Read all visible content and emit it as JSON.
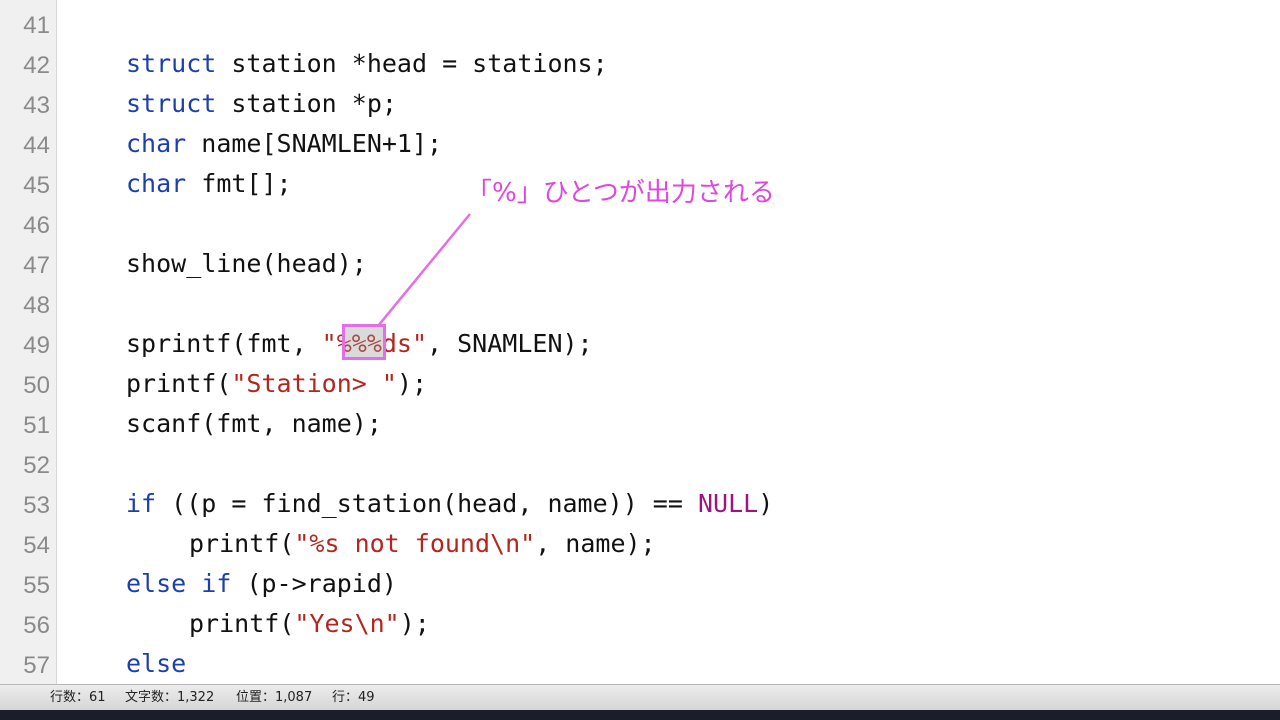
{
  "line_numbers": [
    "41",
    "42",
    "43",
    "44",
    "45",
    "46",
    "47",
    "48",
    "49",
    "50",
    "51",
    "52",
    "53",
    "54",
    "55",
    "56",
    "57"
  ],
  "code": {
    "l42": {
      "kw": "struct",
      "rest": " station *head = stations;"
    },
    "l43": {
      "kw": "struct",
      "rest": " station *p;"
    },
    "l44": {
      "kw": "char",
      "rest": " name[SNAMLEN+1];"
    },
    "l45": {
      "kw": "char",
      "rest": " fmt[];"
    },
    "l47": {
      "text": "show_line(head);"
    },
    "l49": {
      "pre": "sprintf(fmt, ",
      "str": "\"%%%ds\"",
      "post": ", SNAMLEN);"
    },
    "l50": {
      "pre": "printf(",
      "str": "\"Station> \"",
      "post": ");"
    },
    "l51": {
      "text": "scanf(fmt, name);"
    },
    "l53": {
      "kw": "if",
      "pre": " ((p = find_station(head, name)) == ",
      "const": "NULL",
      "post": ")"
    },
    "l54": {
      "pre": "printf(",
      "str": "\"%s not found\\n\"",
      "post": ", name);"
    },
    "l55": {
      "kw1": "else",
      "sp": " ",
      "kw2": "if",
      "post": " (p->rapid)"
    },
    "l56": {
      "pre": "printf(",
      "str": "\"Yes\\n\"",
      "post": ");"
    },
    "l57": {
      "kw": "else"
    }
  },
  "annotation": {
    "text": "「%」ひとつが出力される",
    "color": "#e046e0"
  },
  "status_bar": {
    "lines": "行数：61",
    "chars": "文字数：1,322",
    "position": "位置：1,087",
    "row": "行：49"
  },
  "colors": {
    "keyword": "#1c3fae",
    "string": "#b3261e",
    "constant": "#a01280",
    "gutter_bg": "#f0f0f0"
  }
}
